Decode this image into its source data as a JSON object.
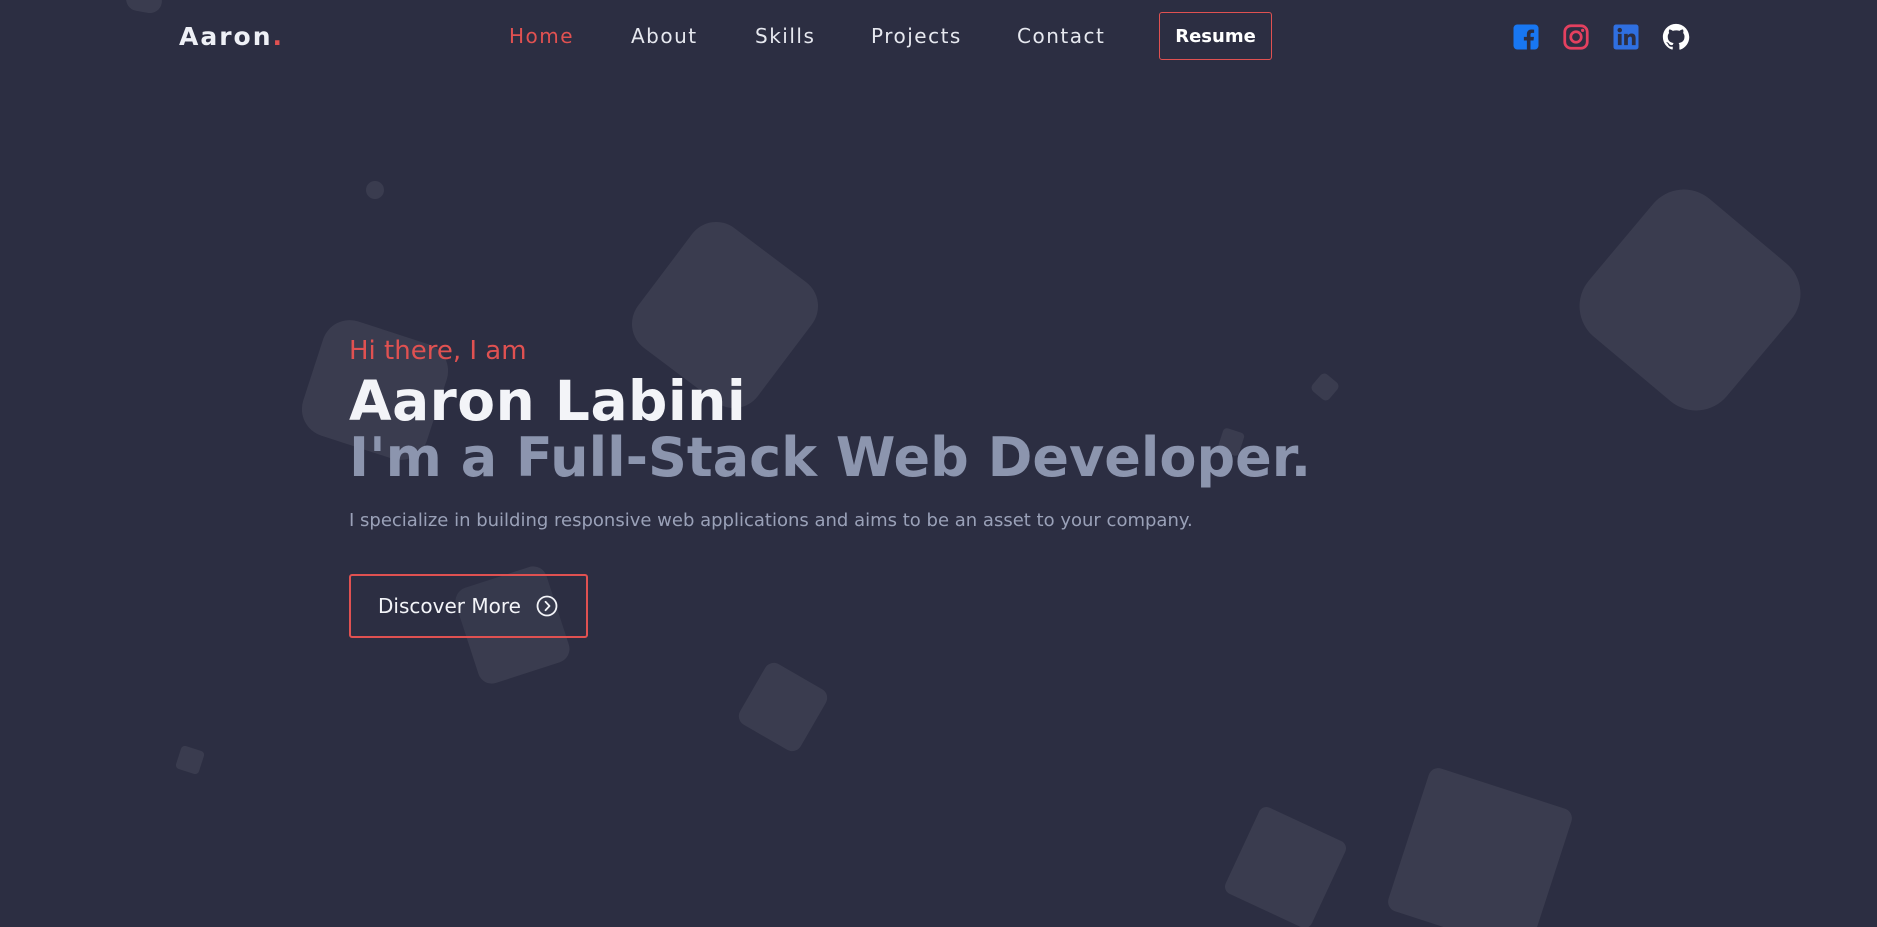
{
  "brand": {
    "name": "Aaron",
    "dot": "."
  },
  "nav": {
    "items": [
      {
        "label": "Home",
        "active": true
      },
      {
        "label": "About",
        "active": false
      },
      {
        "label": "Skills",
        "active": false
      },
      {
        "label": "Projects",
        "active": false
      },
      {
        "label": "Contact",
        "active": false
      }
    ],
    "resume_label": "Resume"
  },
  "social": [
    {
      "icon": "facebook-icon",
      "color": "#1877f2"
    },
    {
      "icon": "instagram-icon",
      "color": "#e4405f"
    },
    {
      "icon": "linkedin-icon",
      "color": "#2f6fe0"
    },
    {
      "icon": "github-icon",
      "color": "#ffffff"
    }
  ],
  "hero": {
    "greeting": "Hi there, I am",
    "name": "Aaron Labini",
    "role": "I'm a Full-Stack Web Developer.",
    "description": "I specialize in building responsive web applications and aims to be an asset to your company.",
    "cta_label": "Discover More",
    "cta_icon": "chevron-right-circle-icon"
  },
  "colors": {
    "background": "#2c2e42",
    "accent": "#e05151",
    "muted": "#8c95ae"
  }
}
